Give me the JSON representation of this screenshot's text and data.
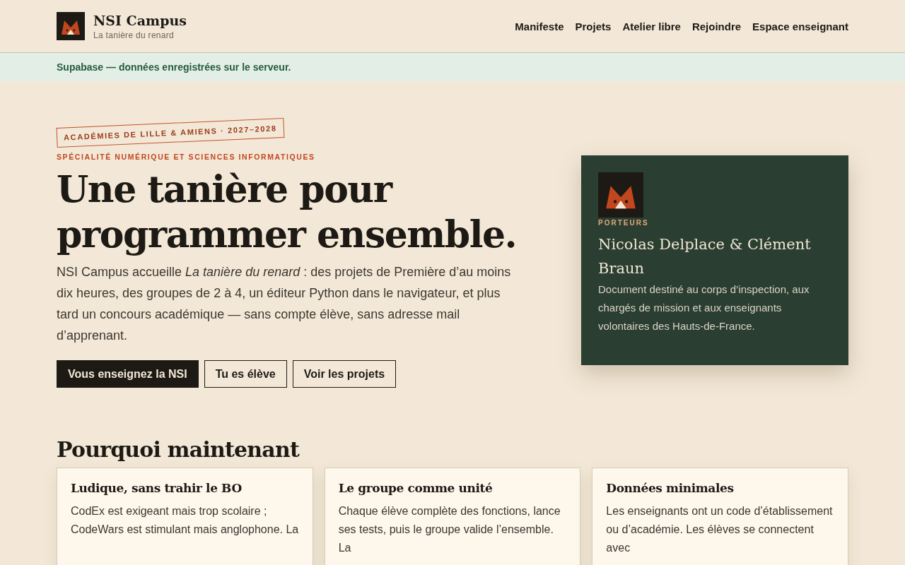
{
  "brand": {
    "title": "NSI Campus",
    "tagline": "La tanière du renard"
  },
  "nav": [
    "Manifeste",
    "Projets",
    "Atelier libre",
    "Rejoindre",
    "Espace enseignant"
  ],
  "status_banner": "Supabase — données enregistrées sur le serveur.",
  "hero": {
    "stamp": "ACADÉMIES DE LILLE & AMIENS · 2027–2028",
    "eyebrow": "SPÉCIALITÉ NUMÉRIQUE ET SCIENCES INFORMATIQUES",
    "title": "Une tanière pour programmer ensemble.",
    "lead": "NSI Campus accueille *La tanière du renard* : des projets de Première d’au moins dix heures, des groupes de 2 à 4, un éditeur Python dans le navigateur, et plus tard un concours académique — sans compte élève, sans adresse mail d’apprenant.",
    "buttons": [
      {
        "label": "Vous enseignez la NSI",
        "kind": "primary"
      },
      {
        "label": "Tu es élève",
        "kind": "outline"
      },
      {
        "label": "Voir les projets",
        "kind": "outline"
      }
    ]
  },
  "porteurs_card": {
    "label": "PORTEURS",
    "names": "Nicolas Delplace & Clément Braun",
    "text": "Document destiné au corps d’inspection, aux chargés de mission et aux enseignants volontaires des Hauts-de-France."
  },
  "why_section": {
    "title": "Pourquoi maintenant",
    "cards": [
      {
        "title": "Ludique, sans trahir le BO",
        "text": "CodEx est exigeant mais trop scolaire ; CodeWars est stimulant mais anglophone. La"
      },
      {
        "title": "Le groupe comme unité",
        "text": "Chaque élève complète des fonctions, lance ses tests, puis le groupe valide l’ensemble. La"
      },
      {
        "title": "Données minimales",
        "text": "Les enseignants ont un code d’établissement ou d’académie. Les élèves se connectent avec"
      }
    ]
  }
}
